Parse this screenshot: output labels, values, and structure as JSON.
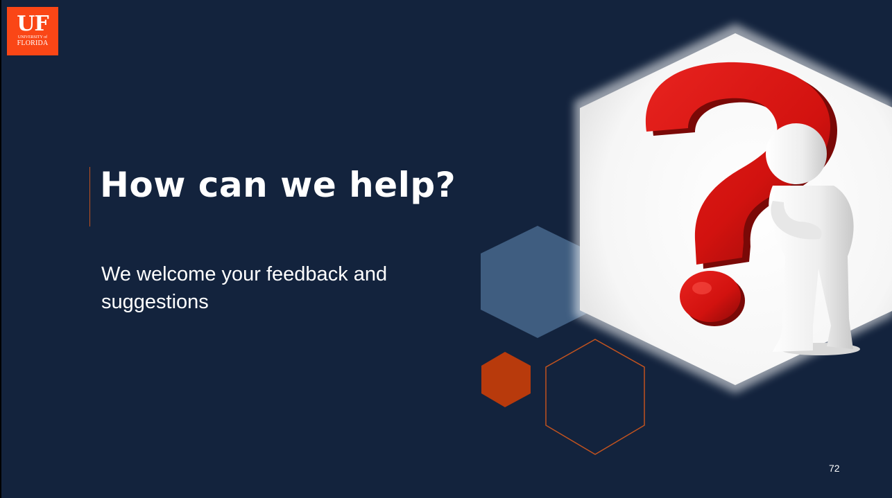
{
  "logo": {
    "mark": "UF",
    "line1": "UNIVERSITY of",
    "line2": "FLORIDA"
  },
  "title": "How can we help?",
  "subtitle": "We welcome your feedback and suggestions",
  "page_number": "72",
  "colors": {
    "background": "#13233d",
    "accent_orange": "#c2531f",
    "uf_orange": "#fa4616",
    "hex_blue": "#3f5d80",
    "text": "#ffffff"
  },
  "image": {
    "subject": "white 3d figure beside a large red question mark in a white hexagon"
  }
}
